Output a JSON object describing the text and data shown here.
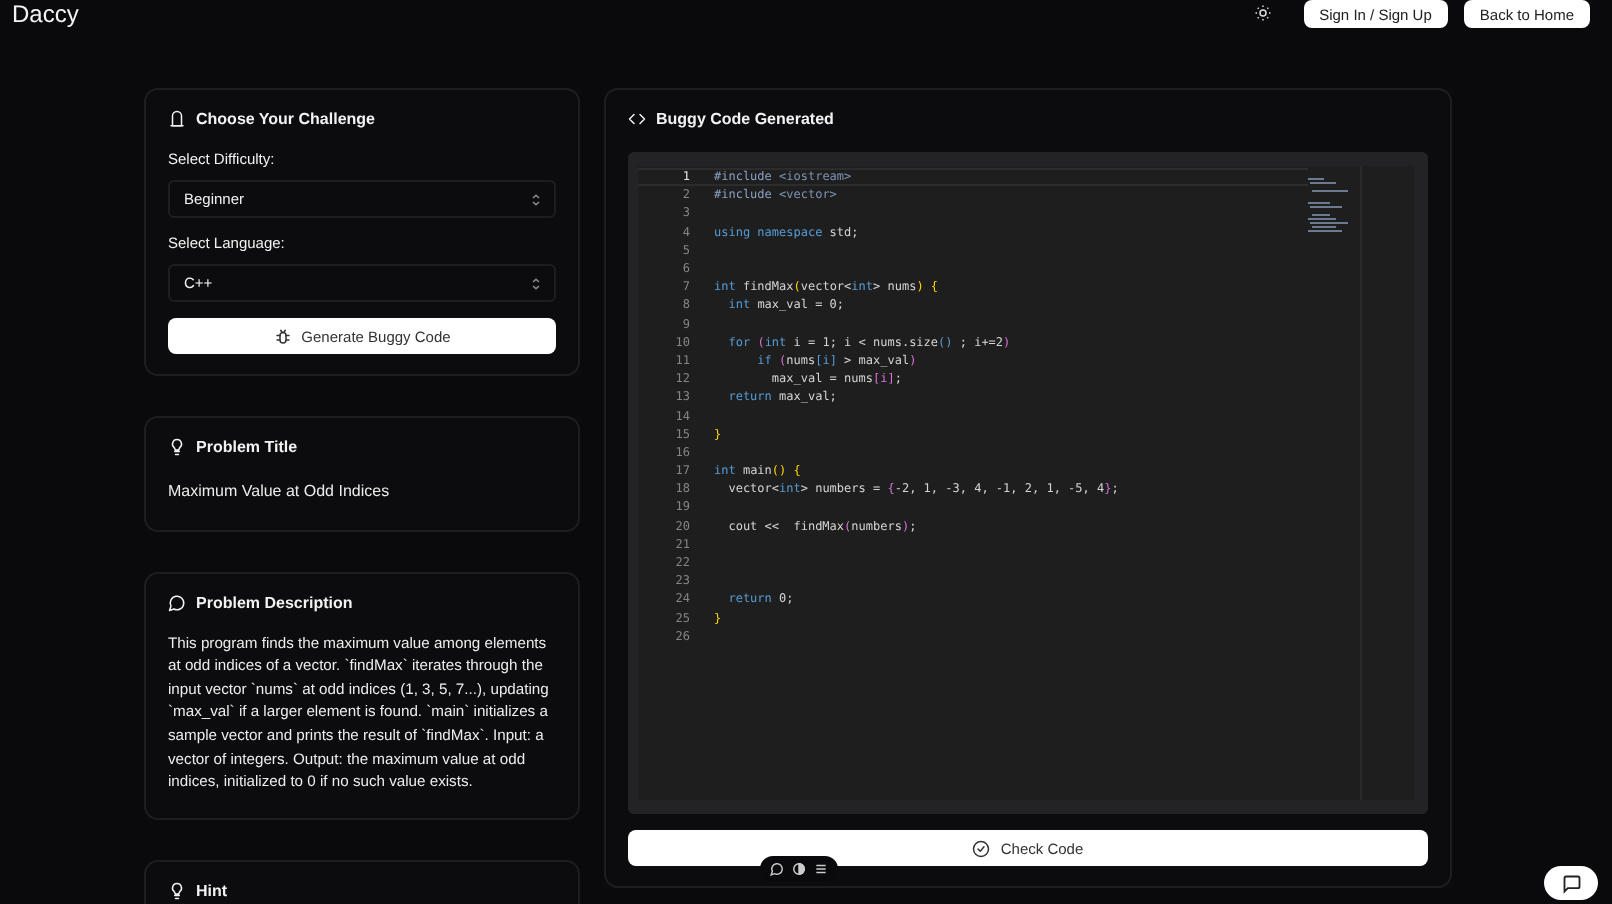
{
  "header": {
    "logo": "Daccy",
    "buttons": [
      "Sign In / Sign Up",
      "Back to Home"
    ]
  },
  "challenge": {
    "title": "Choose Your Challenge",
    "fields": [
      {
        "label": "Select Difficulty:",
        "value": "Beginner"
      },
      {
        "label": "Select Language:",
        "value": "C++"
      }
    ],
    "button": "Generate Buggy Code"
  },
  "problem_title": {
    "title": "Problem Title",
    "text": "Maximum Value at Odd Indices"
  },
  "problem_description": {
    "title": "Problem Description",
    "text": "This program finds the maximum value among elements at odd indices of a vector. `findMax` iterates through the input vector `nums` at odd indices (1, 3, 5, 7...), updating `max_val` if a larger element is found.  `main` initializes a sample vector and prints the result of `findMax`. Input: a vector of integers. Output: the maximum value at odd indices, initialized to 0 if no such value exists."
  },
  "hint": {
    "title": "Hint"
  },
  "code_panel": {
    "title": "Buggy Code Generated",
    "lines": [
      {
        "number": "1",
        "active": true,
        "tokens": [
          {
            "kind": "pp",
            "text": "#include "
          },
          {
            "kind": "inc",
            "text": "<iostream>"
          }
        ]
      },
      {
        "number": "2",
        "active": false,
        "tokens": [
          {
            "kind": "pp",
            "text": "#include "
          },
          {
            "kind": "inc",
            "text": "<vector>"
          }
        ]
      },
      {
        "number": "3",
        "active": false
      },
      {
        "number": "4",
        "active": false,
        "tokens": [
          {
            "kind": "kw",
            "text": "using namespace "
          },
          {
            "kind": "tx",
            "text": "std;"
          }
        ]
      },
      {
        "number": "5",
        "active": false
      },
      {
        "number": "6",
        "active": false
      },
      {
        "number": "7",
        "active": false,
        "tokens": [
          {
            "kind": "kw",
            "text": "int "
          },
          {
            "kind": "tx",
            "text": "findMax"
          },
          {
            "kind": "b1",
            "text": "("
          },
          {
            "kind": "tx",
            "text": "vector<"
          },
          {
            "kind": "kw",
            "text": "int"
          },
          {
            "kind": "tx",
            "text": "> nums"
          },
          {
            "kind": "b1",
            "text": ") {"
          }
        ]
      },
      {
        "number": "8",
        "active": false,
        "tokens": [
          {
            "kind": "kw",
            "text": "  int "
          },
          {
            "kind": "tx",
            "text": "max_val = 0;"
          }
        ]
      },
      {
        "number": "9",
        "active": false
      },
      {
        "number": "10",
        "active": false,
        "tokens": [
          {
            "kind": "kw",
            "text": "  for "
          },
          {
            "kind": "b2",
            "text": "("
          },
          {
            "kind": "kw",
            "text": "int "
          },
          {
            "kind": "tx",
            "text": "i = 1; i < nums.size"
          },
          {
            "kind": "b3",
            "text": "()"
          },
          {
            "kind": "tx",
            "text": " ; i+=2"
          },
          {
            "kind": "b2",
            "text": ")"
          }
        ]
      },
      {
        "number": "11",
        "active": false,
        "tokens": [
          {
            "kind": "kw",
            "text": "      if "
          },
          {
            "kind": "b2",
            "text": "("
          },
          {
            "kind": "tx",
            "text": "nums"
          },
          {
            "kind": "b3",
            "text": "[i]"
          },
          {
            "kind": "tx",
            "text": " > max_val"
          },
          {
            "kind": "b2",
            "text": ")"
          }
        ]
      },
      {
        "number": "12",
        "active": false,
        "tokens": [
          {
            "kind": "tx",
            "text": "        max_val = nums"
          },
          {
            "kind": "b2",
            "text": "[i]"
          },
          {
            "kind": "tx",
            "text": ";"
          }
        ]
      },
      {
        "number": "13",
        "active": false,
        "tokens": [
          {
            "kind": "kw",
            "text": "  return "
          },
          {
            "kind": "tx",
            "text": "max_val;"
          }
        ]
      },
      {
        "number": "14",
        "active": false
      },
      {
        "number": "15",
        "active": false,
        "tokens": [
          {
            "kind": "b1",
            "text": "}"
          }
        ]
      },
      {
        "number": "16",
        "active": false
      },
      {
        "number": "17",
        "active": false,
        "tokens": [
          {
            "kind": "kw",
            "text": "int "
          },
          {
            "kind": "tx",
            "text": "main"
          },
          {
            "kind": "b1",
            "text": "() {"
          }
        ]
      },
      {
        "number": "18",
        "active": false,
        "tokens": [
          {
            "kind": "tx",
            "text": "  vector<"
          },
          {
            "kind": "kw",
            "text": "int"
          },
          {
            "kind": "tx",
            "text": "> numbers = "
          },
          {
            "kind": "b2",
            "text": "{"
          },
          {
            "kind": "tx",
            "text": "-2, 1, -3, 4, -1, 2, 1, -5, 4"
          },
          {
            "kind": "b2",
            "text": "}"
          },
          {
            "kind": "tx",
            "text": ";"
          }
        ]
      },
      {
        "number": "19",
        "active": false
      },
      {
        "number": "20",
        "active": false,
        "tokens": [
          {
            "kind": "tx",
            "text": "  cout <<  findMax"
          },
          {
            "kind": "b2",
            "text": "("
          },
          {
            "kind": "tx",
            "text": "numbers"
          },
          {
            "kind": "b2",
            "text": ")"
          },
          {
            "kind": "tx",
            "text": ";"
          }
        ]
      },
      {
        "number": "21",
        "active": false
      },
      {
        "number": "22",
        "active": false
      },
      {
        "number": "23",
        "active": false
      },
      {
        "number": "24",
        "active": false,
        "tokens": [
          {
            "kind": "kw",
            "text": "  return "
          },
          {
            "kind": "tx",
            "text": "0;"
          }
        ]
      },
      {
        "number": "25",
        "active": false,
        "tokens": [
          {
            "kind": "b1",
            "text": "}"
          }
        ]
      },
      {
        "number": "26",
        "active": false
      }
    ],
    "button": "Check Code"
  }
}
